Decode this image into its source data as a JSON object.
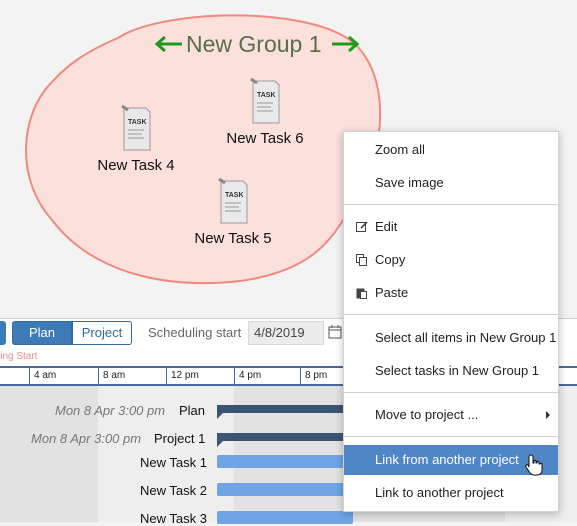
{
  "canvas": {
    "group_title": "New Group 1",
    "tasks": [
      {
        "id": "task4",
        "label": "New Task 4",
        "icon_text": "TASK"
      },
      {
        "id": "task6",
        "label": "New Task 6",
        "icon_text": "TASK"
      },
      {
        "id": "task5",
        "label": "New Task 5",
        "icon_text": "TASK"
      }
    ],
    "colors": {
      "group_fill": "#fbe0dc",
      "group_border": "#f08a7c",
      "arrow": "#1e9b1e",
      "title": "#56704a"
    }
  },
  "toolbar": {
    "view_toggle": {
      "plan": "Plan",
      "project": "Project",
      "selected": "Plan"
    },
    "scheduling_start_label": "Scheduling start",
    "scheduling_start_value": "4/8/2019"
  },
  "gantt": {
    "scheduling_marker": "ling Start",
    "time_ticks": [
      "4 am",
      "8 am",
      "12 pm",
      "4 pm",
      "8 pm"
    ],
    "rows": [
      {
        "date": "Mon 8 Apr 3:00 pm",
        "name": "Plan",
        "kind": "summary"
      },
      {
        "date": "Mon 8 Apr 3:00 pm",
        "name": "Project 1",
        "kind": "summary"
      },
      {
        "date": "",
        "name": "New Task 1",
        "kind": "task"
      },
      {
        "date": "",
        "name": "New Task 2",
        "kind": "task"
      },
      {
        "date": "",
        "name": "New Task 3",
        "kind": "task"
      }
    ]
  },
  "context_menu": {
    "items": [
      {
        "label": "Zoom all",
        "icon": ""
      },
      {
        "label": "Save image",
        "icon": ""
      },
      {
        "label": "Edit",
        "icon": "edit-icon"
      },
      {
        "label": "Copy",
        "icon": "copy-icon"
      },
      {
        "label": "Paste",
        "icon": "paste-icon"
      },
      {
        "label": "Select all items in New Group 1",
        "icon": ""
      },
      {
        "label": "Select tasks in New Group 1",
        "icon": ""
      },
      {
        "label": "Move to project ...",
        "icon": "",
        "submenu": true
      },
      {
        "label": "Link from another project",
        "icon": "",
        "highlighted": true
      },
      {
        "label": "Link to another project",
        "icon": ""
      }
    ],
    "highlight_color": "#4f86c6"
  }
}
